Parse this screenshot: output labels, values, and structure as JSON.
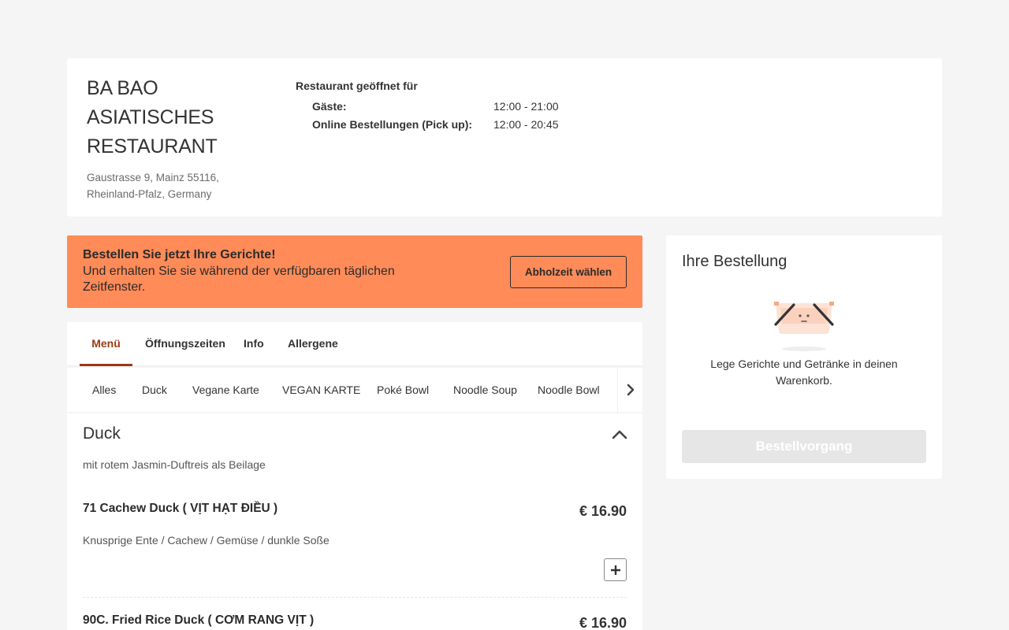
{
  "restaurant": {
    "name": "BA BAO ASIATISCHES RESTAURANT",
    "address": "Gaustrasse 9, Mainz 55116, Rheinland-Pfalz, Germany"
  },
  "hours": {
    "title": "Restaurant geöffnet für",
    "rows": [
      {
        "label": "Gäste:",
        "value": "12:00 - 21:00"
      },
      {
        "label": "Online Bestellungen (Pick up):",
        "value": "12:00 - 20:45"
      }
    ]
  },
  "promo": {
    "title": "Bestellen Sie jetzt Ihre Gerichte!",
    "subtitle": "Und erhalten Sie sie während der verfügbaren täglichen Zeitfenster.",
    "button": "Abholzeit wählen",
    "color": "#ff8b58"
  },
  "tabs": [
    {
      "label": "Menü",
      "active": true
    },
    {
      "label": "Öffnungszeiten",
      "active": false
    },
    {
      "label": "Info",
      "active": false
    },
    {
      "label": "Allergene",
      "active": false
    }
  ],
  "categories": [
    "Alles",
    "Duck",
    "Vegane Karte",
    "VEGAN KARTE",
    "Poké Bowl",
    "Noodle Soup",
    "Noodle Bowl"
  ],
  "section": {
    "title": "Duck",
    "description": "mit rotem Jasmin-Duftreis als Beilage",
    "items": [
      {
        "name": "71 Cachew Duck ( VỊT HẠT ĐIỀU )",
        "price": "€ 16.90",
        "description": "Knusprige Ente / Cachew / Gemüse / dunkle Soße"
      },
      {
        "name": "90C. Fried Rice Duck ( CƠM RANG VỊT )",
        "price": "€ 16.90",
        "description": ""
      }
    ]
  },
  "cart": {
    "title": "Ihre Bestellung",
    "empty_text": "Lege Gerichte und Getränke in deinen Warenkorb.",
    "checkout": "Bestellvorgang"
  },
  "colors": {
    "accent": "#9a3a12",
    "page_bg": "#f5f5f5"
  }
}
